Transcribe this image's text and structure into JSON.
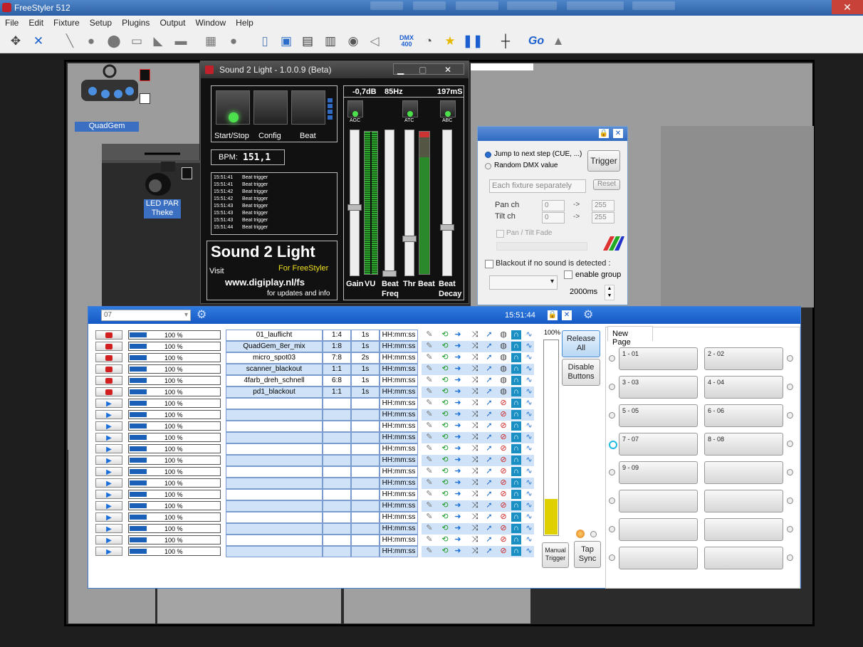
{
  "app": {
    "title": "FreeStyler 512"
  },
  "menu": [
    "File",
    "Edit",
    "Fixture",
    "Setup",
    "Plugins",
    "Output",
    "Window",
    "Help"
  ],
  "toolbar": {
    "dmx_label": "DMX",
    "dmx_sub": "400",
    "go_label": "Go"
  },
  "fixtures": [
    {
      "label": "QuadGem"
    },
    {
      "label": "LED PAR",
      "label2": "Theke"
    }
  ],
  "s2l": {
    "title": "Sound 2 Light - 1.0.0.9 (Beta)",
    "buttons": [
      "Start/Stop",
      "Config",
      "Beat"
    ],
    "bpm_label": "BPM:",
    "bpm_value": "151,1",
    "log": [
      {
        "time": "15:51:41",
        "msg": "Beat trigger"
      },
      {
        "time": "15:51:41",
        "msg": "Beat trigger"
      },
      {
        "time": "15:51:42",
        "msg": "Beat trigger"
      },
      {
        "time": "15:51:42",
        "msg": "Beat trigger"
      },
      {
        "time": "15:51:43",
        "msg": "Beat trigger"
      },
      {
        "time": "15:51:43",
        "msg": "Beat trigger"
      },
      {
        "time": "15:51:43",
        "msg": "Beat trigger"
      },
      {
        "time": "15:51:44",
        "msg": "Beat trigger"
      }
    ],
    "brand": "Sound 2 Light",
    "visit": "Visit",
    "for": "For FreeStyler",
    "url": "www.digiplay.nl/fs",
    "updates": "for updates and info",
    "db": "-0,7dB",
    "hz": "85Hz",
    "ms": "197mS",
    "agc": "AGC",
    "atc": "ATC",
    "abc": "ABC",
    "sliders": [
      "Gain",
      "VU",
      "Beat",
      "Thr",
      "Beat",
      "Beat"
    ],
    "sliders2": [
      "",
      "",
      "Freq",
      "",
      "",
      "Decay"
    ]
  },
  "dmx": {
    "radio1": "Jump to next step (CUE, ...)",
    "radio2": "Random DMX value",
    "trigger": "Trigger",
    "each": "Each fixture separately",
    "reset": "Reset",
    "pan": "Pan ch",
    "tilt": "Tilt ch",
    "pan_v": "0",
    "tilt_v": "0",
    "pan_max": "255",
    "tilt_max": "255",
    "arrow": "->",
    "fade": "Pan / Tilt Fade",
    "blackout": "Blackout if no sound is detected :",
    "group": "enable group",
    "ms": "2000ms"
  },
  "cue": {
    "dropdown": "07",
    "clock": "15:51:44",
    "pct_top": "100%",
    "release": "Release",
    "all": "All",
    "disable": "Disable",
    "buttons": "Buttons",
    "manual": "Manual",
    "trigger": "Trigger",
    "tap": "Tap",
    "sync": "Sync",
    "page_tab": "New Page",
    "rows": [
      {
        "pct": "100 %",
        "name": "01_lauflicht",
        "ratio": "1:4",
        "time": "1s",
        "hms": "HH:mm:ss",
        "stop": true
      },
      {
        "pct": "100 %",
        "name": "QuadGem_8er_mix",
        "ratio": "1:8",
        "time": "1s",
        "hms": "HH:mm:ss",
        "stop": true
      },
      {
        "pct": "100 %",
        "name": "micro_spot03",
        "ratio": "7:8",
        "time": "2s",
        "hms": "HH:mm:ss",
        "stop": true
      },
      {
        "pct": "100 %",
        "name": "scanner_blackout",
        "ratio": "1:1",
        "time": "1s",
        "hms": "HH:mm:ss",
        "stop": true
      },
      {
        "pct": "100 %",
        "name": "4farb_dreh_schnell",
        "ratio": "6:8",
        "time": "1s",
        "hms": "HH:mm:ss",
        "stop": true
      },
      {
        "pct": "100 %",
        "name": "pd1_blackout",
        "ratio": "1:1",
        "time": "1s",
        "hms": "HH:mm:ss",
        "stop": true
      },
      {
        "pct": "100 %",
        "name": "",
        "ratio": "",
        "time": "",
        "hms": "HH:mm:ss",
        "stop": false
      },
      {
        "pct": "100 %",
        "name": "",
        "ratio": "",
        "time": "",
        "hms": "HH:mm:ss",
        "stop": false
      },
      {
        "pct": "100 %",
        "name": "",
        "ratio": "",
        "time": "",
        "hms": "HH:mm:ss",
        "stop": false
      },
      {
        "pct": "100 %",
        "name": "",
        "ratio": "",
        "time": "",
        "hms": "HH:mm:ss",
        "stop": false
      },
      {
        "pct": "100 %",
        "name": "",
        "ratio": "",
        "time": "",
        "hms": "HH:mm:ss",
        "stop": false
      },
      {
        "pct": "100 %",
        "name": "",
        "ratio": "",
        "time": "",
        "hms": "HH:mm:ss",
        "stop": false
      },
      {
        "pct": "100 %",
        "name": "",
        "ratio": "",
        "time": "",
        "hms": "HH:mm:ss",
        "stop": false
      },
      {
        "pct": "100 %",
        "name": "",
        "ratio": "",
        "time": "",
        "hms": "HH:mm:ss",
        "stop": false
      },
      {
        "pct": "100 %",
        "name": "",
        "ratio": "",
        "time": "",
        "hms": "HH:mm:ss",
        "stop": false
      },
      {
        "pct": "100 %",
        "name": "",
        "ratio": "",
        "time": "",
        "hms": "HH:mm:ss",
        "stop": false
      },
      {
        "pct": "100 %",
        "name": "",
        "ratio": "",
        "time": "",
        "hms": "HH:mm:ss",
        "stop": false
      },
      {
        "pct": "100 %",
        "name": "",
        "ratio": "",
        "time": "",
        "hms": "HH:mm:ss",
        "stop": false
      },
      {
        "pct": "100 %",
        "name": "",
        "ratio": "",
        "time": "",
        "hms": "HH:mm:ss",
        "stop": false
      },
      {
        "pct": "100 %",
        "name": "",
        "ratio": "",
        "time": "",
        "hms": "HH:mm:ss",
        "stop": false
      }
    ],
    "pages": [
      "1 - 01",
      "2 - 02",
      "3 - 03",
      "4 - 04",
      "5 - 05",
      "6 - 06",
      "7 - 07",
      "8 - 08",
      "9 - 09",
      "",
      "",
      "",
      "",
      "",
      "",
      ""
    ]
  },
  "colors": {
    "accent": "#1659c4",
    "row_blue": "#cfe2f7",
    "led_green": "#4ce04c"
  }
}
